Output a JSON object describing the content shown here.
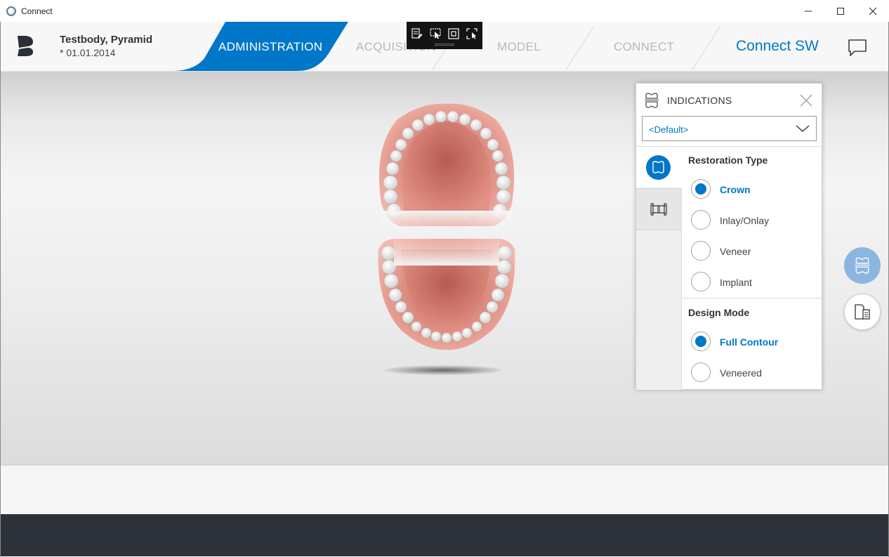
{
  "window": {
    "title": "Connect",
    "controls": [
      "minimize-icon",
      "maximize-icon",
      "close-icon"
    ]
  },
  "header": {
    "patient_name": "Testbody, Pyramid",
    "patient_date": "* 01.01.2014",
    "tabs": [
      {
        "label": "ADMINISTRATION",
        "active": true
      },
      {
        "label": "ACQUISITION",
        "active": false
      },
      {
        "label": "MODEL",
        "active": false
      },
      {
        "label": "CONNECT",
        "active": false
      }
    ],
    "brand": "Connect SW",
    "active_color": "#0077c8"
  },
  "floating_toolbar": {
    "icons": [
      "edit-list-icon",
      "select-cursor-icon",
      "frame-icon",
      "fullscreen-select-icon"
    ]
  },
  "indications_panel": {
    "title": "INDICATIONS",
    "dropdown_value": "<Default>",
    "side_tabs": [
      "tooth-crown-icon",
      "bridge-icon"
    ],
    "restoration_type": {
      "title": "Restoration Type",
      "options": [
        {
          "label": "Crown",
          "checked": true
        },
        {
          "label": "Inlay/Onlay",
          "checked": false
        },
        {
          "label": "Veneer",
          "checked": false
        },
        {
          "label": "Implant",
          "checked": false
        }
      ]
    },
    "design_mode": {
      "title": "Design Mode",
      "options": [
        {
          "label": "Full Contour",
          "checked": true
        },
        {
          "label": "Veneered",
          "checked": false
        }
      ]
    }
  },
  "right_buttons": [
    "jaw-icon",
    "document-icon"
  ],
  "colors": {
    "accent": "#0077c8",
    "bottom_bar": "#2d323a",
    "fab_active": "#8ab6df"
  }
}
